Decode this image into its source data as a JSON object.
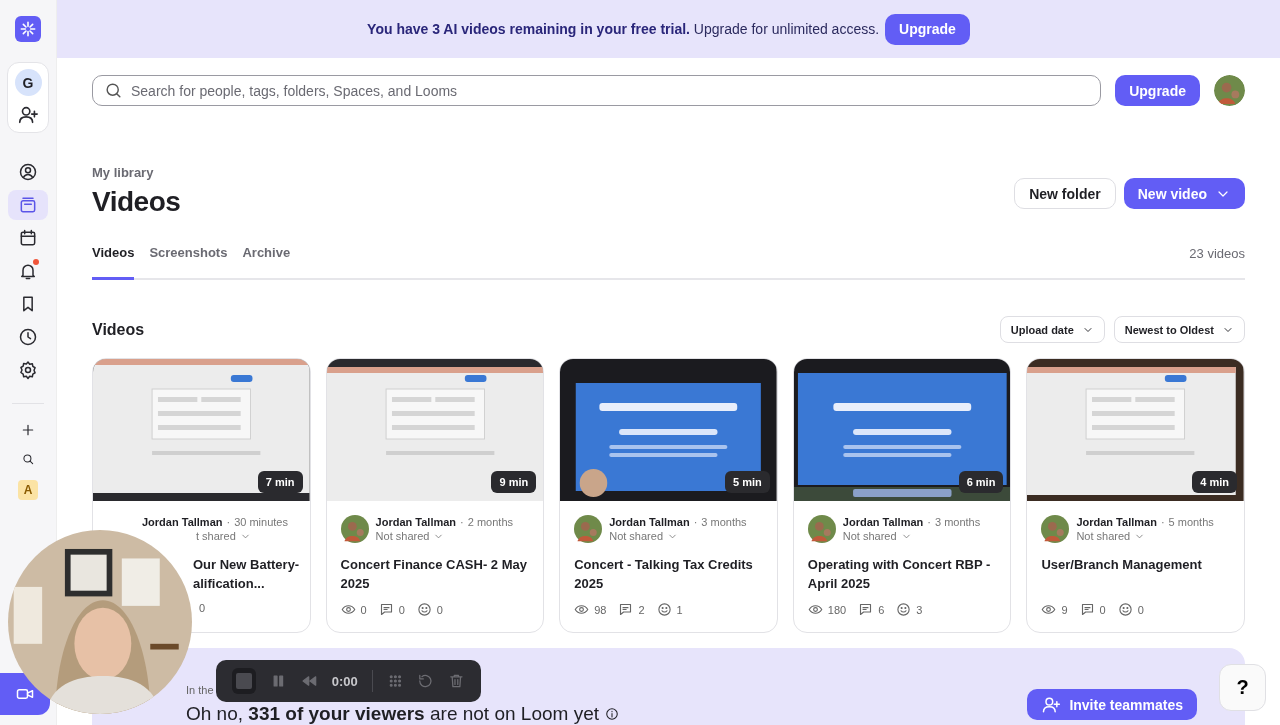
{
  "banner": {
    "text": "**You have 3 AI videos remaining in your free trial.** Upgrade for unlimited access.",
    "button": "Upgrade"
  },
  "sidebar": {
    "workspace": "G",
    "items": [
      {
        "kind": "profile",
        "selected": false,
        "dot": false
      },
      {
        "kind": "library",
        "selected": true,
        "dot": false
      },
      {
        "kind": "calendar",
        "selected": false,
        "dot": false
      },
      {
        "kind": "bell",
        "selected": false,
        "dot": true
      },
      {
        "kind": "bookmark",
        "selected": false,
        "dot": false
      },
      {
        "kind": "clock",
        "selected": false,
        "dot": false
      },
      {
        "kind": "settings",
        "selected": false,
        "dot": false
      }
    ],
    "space_badge": "A"
  },
  "search": {
    "placeholder": "Search for people, tags, folders, Spaces, and Looms"
  },
  "top_button": "Upgrade",
  "header": {
    "breadcrumb": "My library",
    "title": "Videos",
    "new_folder": "New folder",
    "new_video": "New video"
  },
  "tabs": [
    {
      "label": "Videos",
      "selected": true
    },
    {
      "label": "Screenshots",
      "selected": false
    },
    {
      "label": "Archive",
      "selected": false
    }
  ],
  "count": "23 videos",
  "section": {
    "title": "Videos",
    "sort_field": "Upload date",
    "sort_order": "Newest to Oldest"
  },
  "videos": [
    {
      "duration": "7 min",
      "author": "Jordan Tallman",
      "separator": "·",
      "time": "30 minutes",
      "sharing": "t shared",
      "title": "Our New Battery- alification...",
      "stats": [
        {
          "kind": "count",
          "value": "0"
        }
      ]
    },
    {
      "duration": "9 min",
      "author": "Jordan Tallman",
      "separator": "·",
      "time": "2 months",
      "sharing": "Not shared",
      "title": "Concert Finance CASH- 2 May 2025",
      "stats": [
        {
          "kind": "views",
          "value": "0"
        },
        {
          "kind": "comments",
          "value": "0"
        },
        {
          "kind": "reactions",
          "value": "0"
        }
      ]
    },
    {
      "duration": "5 min",
      "author": "Jordan Tallman",
      "separator": "·",
      "time": "3 months",
      "sharing": "Not shared",
      "title": "Concert - Talking Tax Credits 2025",
      "stats": [
        {
          "kind": "views",
          "value": "98"
        },
        {
          "kind": "comments",
          "value": "2"
        },
        {
          "kind": "reactions",
          "value": "1"
        }
      ]
    },
    {
      "duration": "6 min",
      "author": "Jordan Tallman",
      "separator": "·",
      "time": "3 months",
      "sharing": "Not shared",
      "title": "Operating with Concert RBP - April 2025",
      "stats": [
        {
          "kind": "views",
          "value": "180"
        },
        {
          "kind": "comments",
          "value": "6"
        },
        {
          "kind": "reactions",
          "value": "3"
        }
      ]
    },
    {
      "duration": "4 min",
      "author": "Jordan Tallman",
      "separator": "·",
      "time": "5 months",
      "sharing": "Not shared",
      "title": "User/Branch Management",
      "stats": [
        {
          "kind": "views",
          "value": "9"
        },
        {
          "kind": "comments",
          "value": "0"
        },
        {
          "kind": "reactions",
          "value": "0"
        }
      ]
    }
  ],
  "promo": {
    "label": "In the",
    "headline": "Oh no, **331 of your viewers** are not on Loom yet",
    "button": "Invite teammates"
  },
  "recorder": {
    "time": "0:00"
  },
  "help": "?"
}
